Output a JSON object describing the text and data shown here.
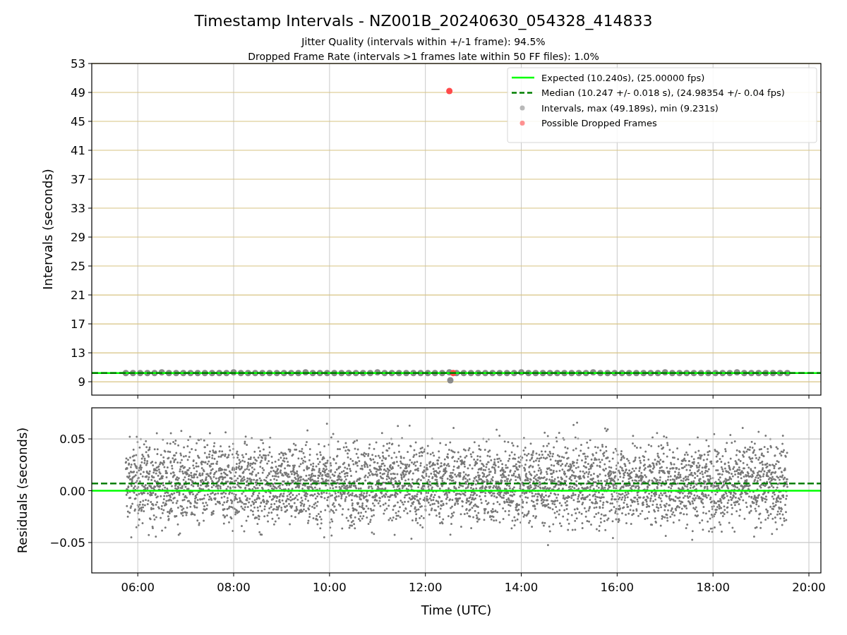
{
  "figure": {
    "title": "Timestamp Intervals - NZ001B_20240630_054328_414833",
    "subtitles": [
      "Jitter Quality (intervals within +/-1 frame): 94.5%",
      "Dropped Frame Rate (intervals >1 frames late within 50 FF files): 1.0%"
    ]
  },
  "panels": [
    {
      "chart_data": {
        "type": "scatter",
        "ylabel": "Intervals (seconds)",
        "legend": true,
        "grid": true,
        "xlim": [
          5.04,
          20.25
        ],
        "ylim": [
          7.15,
          53
        ],
        "yticks": [
          {
            "value": 9,
            "label": "9"
          },
          {
            "value": 13,
            "label": "13"
          },
          {
            "value": 17,
            "label": "17"
          },
          {
            "value": 21,
            "label": "21"
          },
          {
            "value": 25,
            "label": "25"
          },
          {
            "value": 29,
            "label": "29"
          },
          {
            "value": 33,
            "label": "33"
          },
          {
            "value": 37,
            "label": "37"
          },
          {
            "value": 41,
            "label": "41"
          },
          {
            "value": 45,
            "label": "45"
          },
          {
            "value": 49,
            "label": "49"
          },
          {
            "value": 53,
            "label": "53"
          }
        ],
        "series": [
          {
            "name": "Expected (10.240s), (25.00000 fps)",
            "type": "line",
            "line_style": "solid",
            "color": "#00ff00",
            "x": [
              5.04,
              20.25
            ],
            "values": [
              10.2,
              10.2
            ]
          },
          {
            "name": "Median (10.247 +/- 0.018 s), (24.98354 +/- 0.04 fps)",
            "type": "line",
            "line_style": "dashed",
            "color": "#007f00",
            "x": [
              5.04,
              20.25
            ],
            "values": [
              10.2,
              10.2
            ]
          },
          {
            "name": "Intervals, max (49.189s), min (9.231s)",
            "type": "scatter",
            "color": "#8a8a8a",
            "x": [
              5.75,
              5.9,
              6.05,
              6.2,
              6.35,
              6.5,
              6.65,
              6.8,
              6.95,
              7.1,
              7.25,
              7.4,
              7.55,
              7.7,
              7.85,
              8,
              8.15,
              8.3,
              8.45,
              8.6,
              8.75,
              8.9,
              9.05,
              9.2,
              9.35,
              9.5,
              9.65,
              9.8,
              9.95,
              10.1,
              10.25,
              10.4,
              10.55,
              10.7,
              10.85,
              11,
              11.15,
              11.3,
              11.45,
              11.6,
              11.75,
              11.9,
              12.05,
              12.2,
              12.35,
              12.5,
              12.65,
              12.8,
              12.95,
              13.1,
              13.25,
              13.4,
              13.55,
              13.7,
              13.85,
              14,
              14.15,
              14.3,
              14.45,
              14.6,
              14.75,
              14.9,
              15.05,
              15.2,
              15.35,
              15.5,
              15.65,
              15.8,
              15.95,
              16.1,
              16.25,
              16.4,
              16.55,
              16.7,
              16.85,
              17,
              17.15,
              17.3,
              17.45,
              17.6,
              17.75,
              17.9,
              18.05,
              18.2,
              18.35,
              18.5,
              18.65,
              18.8,
              18.95,
              19.1,
              19.25,
              19.4,
              19.55,
              12.52
            ],
            "values": [
              10.2,
              10.2,
              10.2,
              10.2,
              10.2,
              10.3,
              10.2,
              10.2,
              10.2,
              10.2,
              10.2,
              10.2,
              10.2,
              10.2,
              10.2,
              10.3,
              10.2,
              10.2,
              10.2,
              10.2,
              10.2,
              10.2,
              10.2,
              10.2,
              10.2,
              10.3,
              10.2,
              10.2,
              10.2,
              10.2,
              10.2,
              10.2,
              10.2,
              10.2,
              10.2,
              10.3,
              10.2,
              10.2,
              10.2,
              10.2,
              10.2,
              10.2,
              10.2,
              10.2,
              10.2,
              10.3,
              10.2,
              10.2,
              10.2,
              10.2,
              10.2,
              10.2,
              10.2,
              10.2,
              10.2,
              10.3,
              10.2,
              10.2,
              10.2,
              10.2,
              10.2,
              10.2,
              10.2,
              10.2,
              10.2,
              10.3,
              10.2,
              10.2,
              10.2,
              10.2,
              10.2,
              10.2,
              10.2,
              10.2,
              10.2,
              10.3,
              10.2,
              10.2,
              10.2,
              10.2,
              10.2,
              10.2,
              10.2,
              10.2,
              10.2,
              10.3,
              10.2,
              10.2,
              10.2,
              10.2,
              10.2,
              10.2,
              10.2,
              9.2
            ]
          },
          {
            "name": "Possible Dropped Frames",
            "type": "scatter",
            "color": "#ff4a4a",
            "x": [
              12.5,
              12.58
            ],
            "values": [
              49.2,
              10.2
            ]
          }
        ]
      }
    },
    {
      "chart_data": {
        "type": "scatter",
        "xlabel": "Time (UTC)",
        "ylabel": "Residuals (seconds)",
        "legend": false,
        "grid": true,
        "xlim": [
          5.04,
          20.25
        ],
        "ylim": [
          -0.0793,
          0.08
        ],
        "xticks": [
          {
            "value": 6,
            "label": "06:00"
          },
          {
            "value": 8,
            "label": "08:00"
          },
          {
            "value": 10,
            "label": "10:00"
          },
          {
            "value": 12,
            "label": "12:00"
          },
          {
            "value": 14,
            "label": "14:00"
          },
          {
            "value": 16,
            "label": "16:00"
          },
          {
            "value": 18,
            "label": "18:00"
          },
          {
            "value": 20,
            "label": "20:00"
          }
        ],
        "yticks": [
          {
            "value": 0.05,
            "label": "0.05"
          },
          {
            "value": 0,
            "label": "0.00"
          },
          {
            "value": -0.05,
            "label": "−0.05"
          }
        ],
        "series": [
          {
            "type": "line",
            "line_style": "solid",
            "color": "#00ff00",
            "x": [
              5.04,
              20.25
            ],
            "values": [
              0,
              0
            ]
          },
          {
            "type": "line",
            "line_style": "dashed",
            "color": "#007f00",
            "x": [
              5.04,
              20.25
            ],
            "values": [
              0.007,
              0.007
            ]
          }
        ]
      }
    }
  ]
}
